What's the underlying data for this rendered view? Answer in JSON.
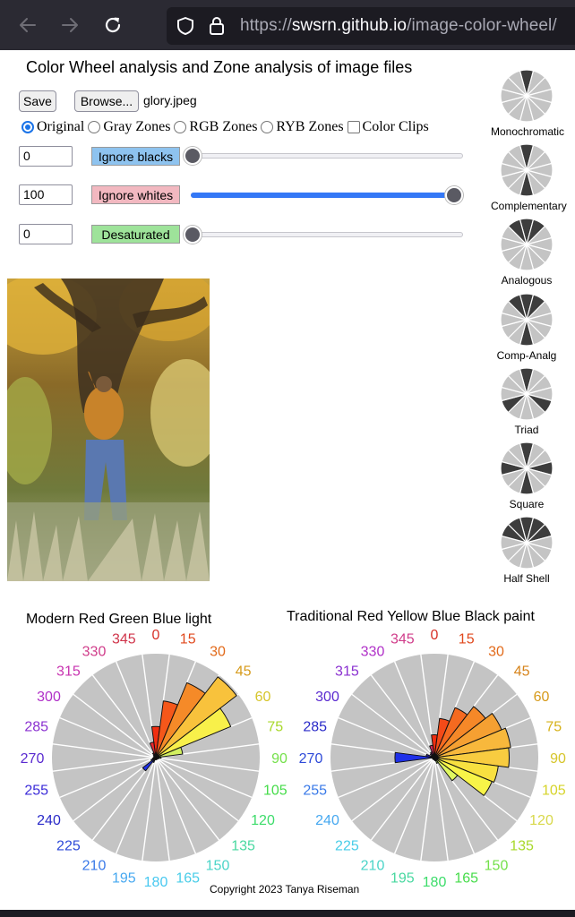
{
  "browser": {
    "url_prefix": "https://",
    "url_domain": "swsrn.github.io",
    "url_path": "/image-color-wheel/"
  },
  "page": {
    "title": "Color Wheel analysis and Zone analysis of image files",
    "save_label": "Save",
    "browse_label": "Browse...",
    "file_name": "glory.jpeg",
    "modes": [
      {
        "label": "Original",
        "selected": true
      },
      {
        "label": "Gray Zones",
        "selected": false
      },
      {
        "label": "RGB Zones",
        "selected": false
      },
      {
        "label": "RYB Zones",
        "selected": false
      }
    ],
    "color_clips_label": "Color Clips",
    "color_clips_checked": false,
    "sliders": [
      {
        "value": "0",
        "label": "Ignore blacks",
        "level": 0.0,
        "color": "#8ec3ef"
      },
      {
        "value": "100",
        "label": "Ignore whites",
        "level": 1.0,
        "color": "#f2b8c0"
      },
      {
        "value": "0",
        "label": "Desaturated",
        "level": 0.0,
        "color": "#9ee39a"
      }
    ],
    "schemes": [
      {
        "label": "Monochromatic",
        "dark": [
          0
        ]
      },
      {
        "label": "Complementary",
        "dark": [
          0,
          6
        ]
      },
      {
        "label": "Analogous",
        "dark": [
          11,
          0,
          1
        ]
      },
      {
        "label": "Comp-Analg",
        "dark": [
          11,
          0,
          1,
          6
        ]
      },
      {
        "label": "Triad",
        "dark": [
          0,
          4,
          8
        ]
      },
      {
        "label": "Square",
        "dark": [
          0,
          3,
          6,
          9
        ]
      },
      {
        "label": "Half Shell",
        "dark": [
          10,
          11,
          0,
          1,
          2
        ]
      }
    ],
    "copyright": "Copyright 2023 Tanya Riseman"
  },
  "wheels": [
    {
      "title": "Modern Red Green Blue light",
      "hue_labels": [
        "0",
        "15",
        "30",
        "45",
        "60",
        "75",
        "90",
        "105",
        "120",
        "135",
        "150",
        "165",
        "180",
        "195",
        "210",
        "225",
        "240",
        "255",
        "270",
        "285",
        "300",
        "315",
        "330",
        "345"
      ],
      "label_colors": [
        "#d73027",
        "#e0481c",
        "#e26a1a",
        "#d69a1a",
        "#d6c52a",
        "#a8d82a",
        "#74e04a",
        "#46dc4a",
        "#3cdc6a",
        "#48d8a0",
        "#4ad4c8",
        "#48cde8",
        "#48c8f0",
        "#46a8f0",
        "#3a7ae8",
        "#2e4ad8",
        "#2a2ac8",
        "#3a2ad8",
        "#5a2ad0",
        "#8a30d0",
        "#b030c8",
        "#c834b0",
        "#d03c8a",
        "#d0344a"
      ],
      "values": [
        0.3,
        0.55,
        0.78,
        0.98,
        0.78,
        0.26,
        0.05,
        0.03,
        0.02,
        0.02,
        0.02,
        0.02,
        0.02,
        0.02,
        0.05,
        0.16,
        0.05,
        0.03,
        0.02,
        0.02,
        0.02,
        0.03,
        0.05,
        0.15
      ],
      "bar_colors": [
        "#f02d10",
        "#f5571a",
        "#f58a28",
        "#f8c23c",
        "#f8f04a",
        "#d2f060",
        "#98ea5c",
        "#6ee868",
        "#64e890",
        "#6ae0c0",
        "#6ad4e8",
        "#60c2f0",
        "#50a0f0",
        "#3c7ae8",
        "#2a50e0",
        "#1e30e8",
        "#2a20d8",
        "#4a20c8",
        "#7a28c0",
        "#a030b8",
        "#c030a8",
        "#d02c80",
        "#e02a50",
        "#e82a30"
      ]
    },
    {
      "title": "Traditional Red Yellow Blue Black paint",
      "hue_labels": [
        "0",
        "15",
        "30",
        "45",
        "60",
        "75",
        "90",
        "105",
        "120",
        "135",
        "150",
        "165",
        "180",
        "195",
        "210",
        "225",
        "240",
        "255",
        "270",
        "285",
        "300",
        "315",
        "330",
        "345"
      ],
      "label_colors": [
        "#d73027",
        "#e0481c",
        "#e26a1a",
        "#d6831a",
        "#d69a1a",
        "#d6b21a",
        "#d6c52a",
        "#d6d42a",
        "#d8d84a",
        "#a8d82a",
        "#74e04a",
        "#46dc4a",
        "#3cdc6a",
        "#48d8a0",
        "#4ad4c8",
        "#48cde8",
        "#46a8f0",
        "#3a7ae8",
        "#2e4ad8",
        "#2a2ac8",
        "#5a2ad0",
        "#8a30d0",
        "#b030c8",
        "#d03c8a"
      ],
      "values": [
        0.22,
        0.38,
        0.52,
        0.62,
        0.7,
        0.74,
        0.72,
        0.62,
        0.6,
        0.28,
        0.06,
        0.03,
        0.02,
        0.02,
        0.02,
        0.02,
        0.02,
        0.02,
        0.38,
        0.08,
        0.03,
        0.05,
        0.06,
        0.12
      ],
      "bar_colors": [
        "#f02d10",
        "#f54a18",
        "#f56a20",
        "#f58828",
        "#f5a032",
        "#f8b83c",
        "#f8cc40",
        "#f8e040",
        "#f8f448",
        "#e0f860",
        "#b0f060",
        "#7ce864",
        "#60e890",
        "#60dcc0",
        "#60c8e8",
        "#58b0f0",
        "#4890f0",
        "#3a68e8",
        "#1e30e8",
        "#2a20d8",
        "#5020c8",
        "#8028c0",
        "#b030b0",
        "#d82a60"
      ]
    }
  ]
}
